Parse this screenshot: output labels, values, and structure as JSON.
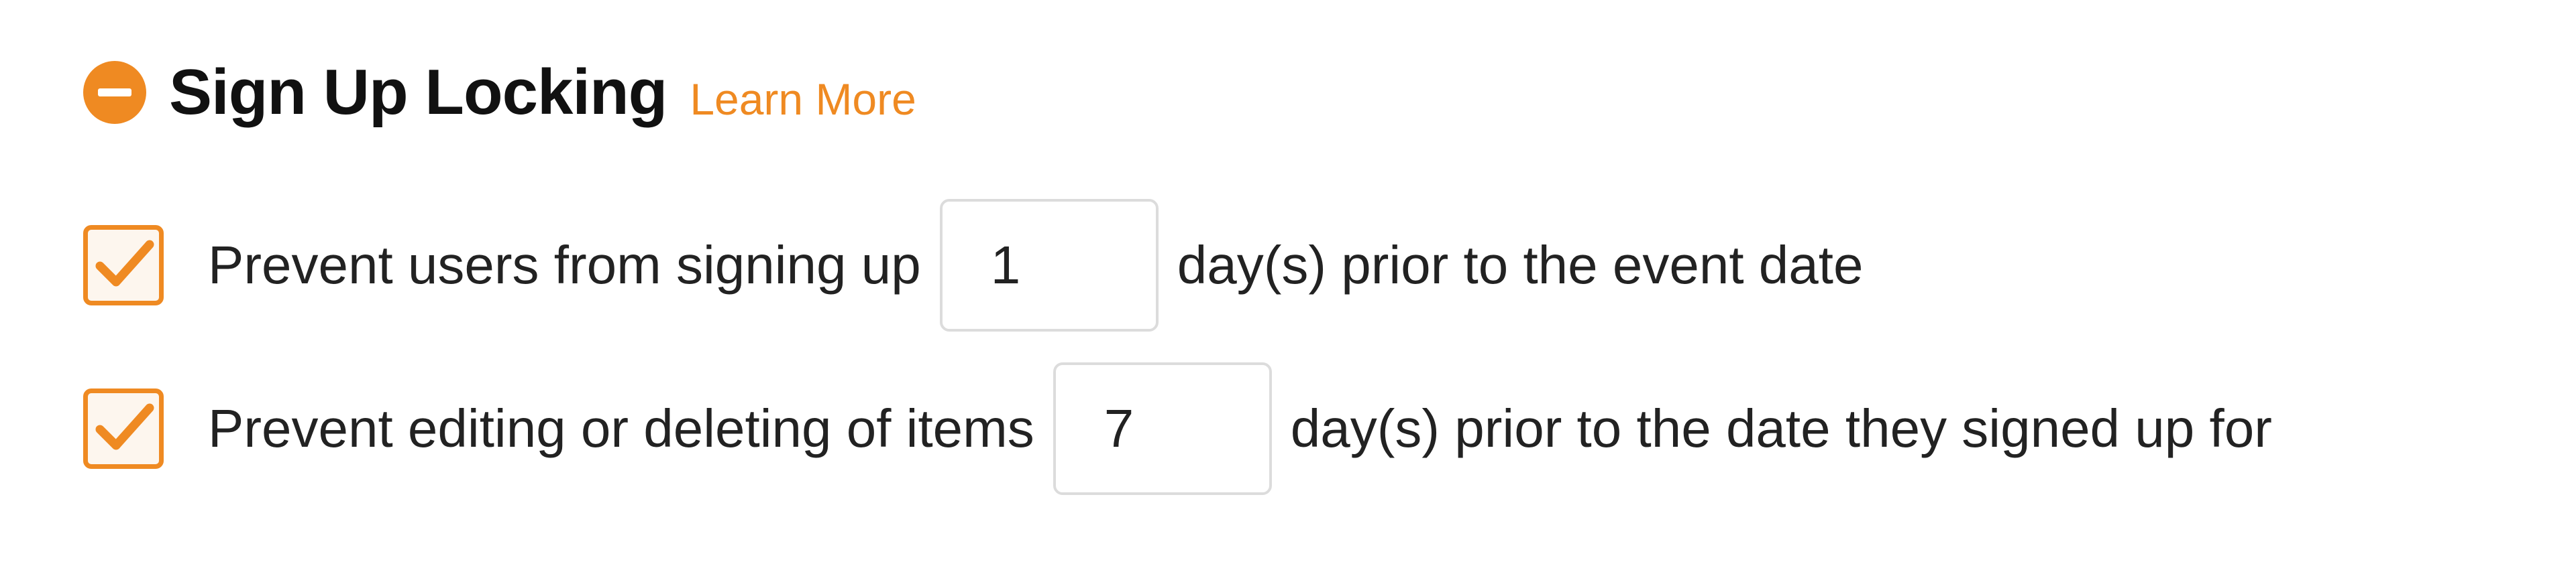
{
  "section": {
    "title": "Sign Up Locking",
    "learn_more": "Learn More",
    "collapse_icon": "minus-circle-icon",
    "accent_color": "#ef8a22"
  },
  "settings": [
    {
      "checked": true,
      "label": "Prevent users from signing up",
      "days_value": "1",
      "suffix": "day(s) prior to the event date"
    },
    {
      "checked": true,
      "label": "Prevent editing or deleting of items",
      "days_value": "7",
      "suffix": "day(s) prior to the date they signed up for"
    }
  ],
  "icons": {
    "checkbox_mark": "checkmark-icon"
  }
}
